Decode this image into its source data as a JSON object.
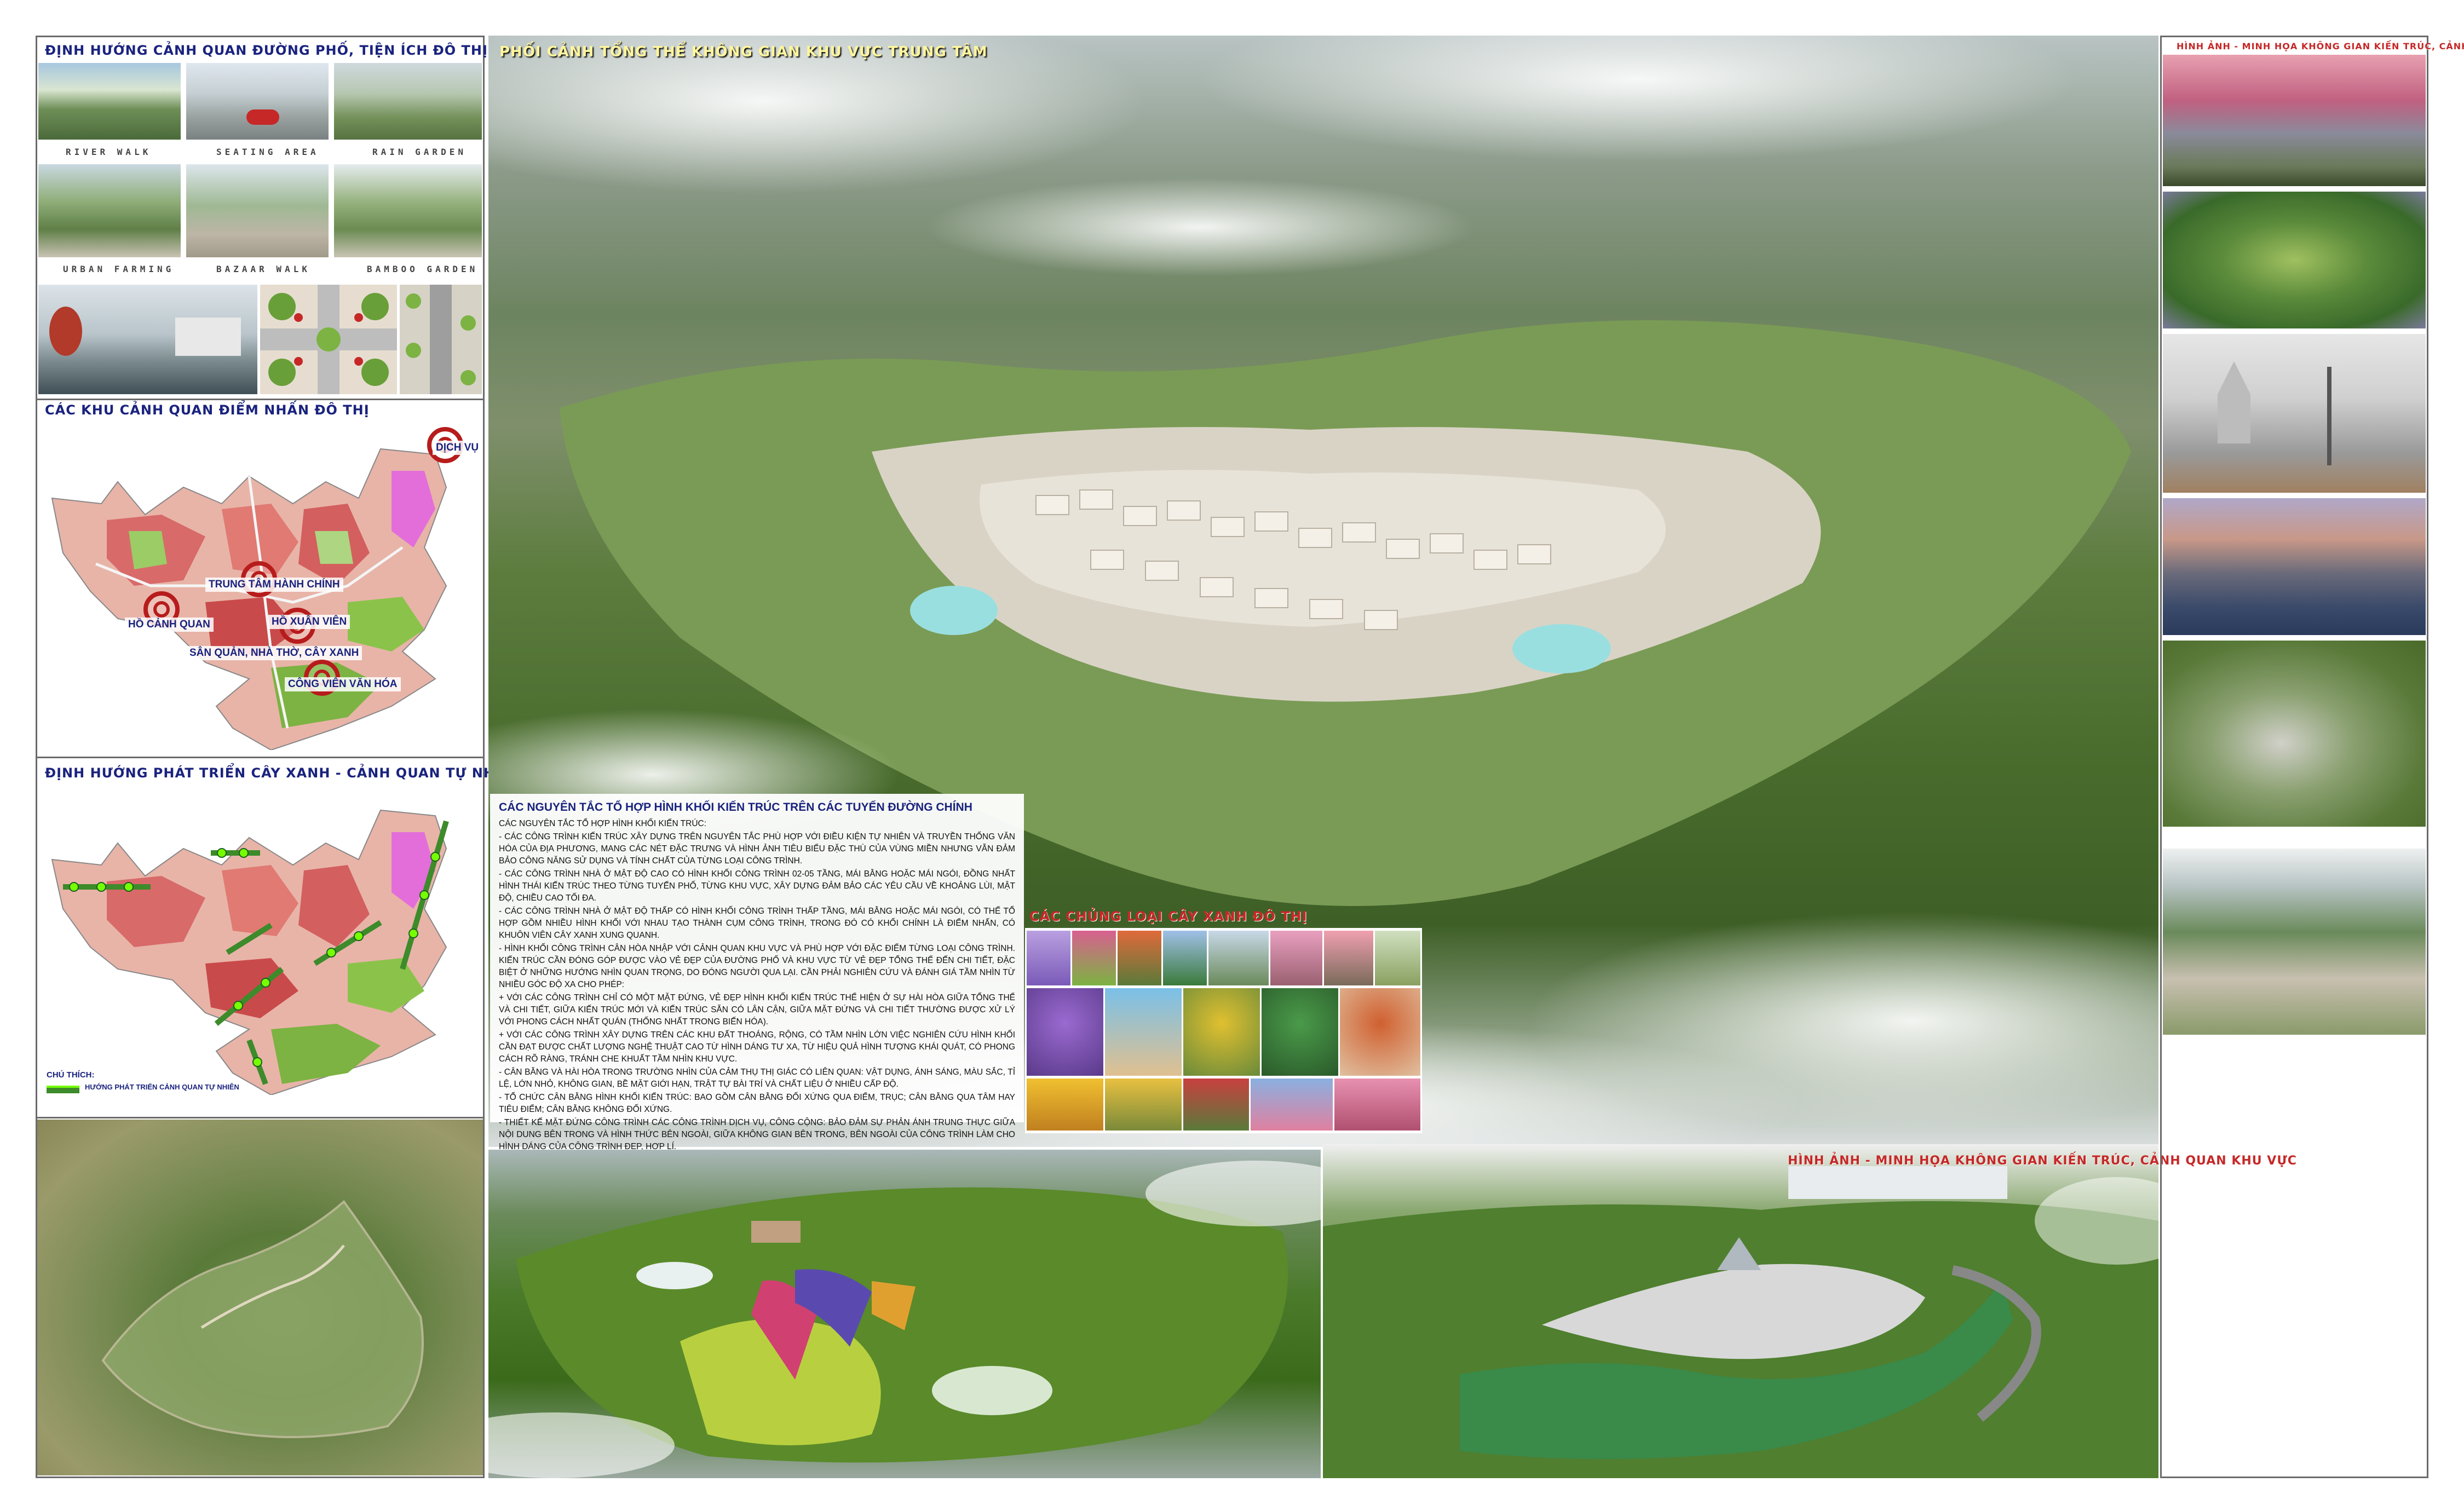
{
  "panels": {
    "street": {
      "title": "ĐỊNH HƯỚNG CẢNH QUAN ĐƯỜNG PHỐ, TIỆN ÍCH ĐÔ THỊ",
      "captions_row1": [
        "RIVER WALK",
        "SEATING AREA",
        "RAIN GARDEN"
      ],
      "captions_row2": [
        "URBAN FARMING",
        "BAZAAR WALK",
        "BAMBOO GARDEN"
      ]
    },
    "landmarks": {
      "title": "CÁC KHU CẢNH QUAN ĐIỂM NHẤN ĐÔ THỊ",
      "labels": {
        "dich_vu": "DỊCH VỤ",
        "trung_tam": "TRUNG TÂM HÀNH CHÍNH",
        "ho_canh_quan": "HỒ CẢNH QUAN",
        "ho_xuan_vien": "HỒ XUÂN VIÊN",
        "san_quan": "SÂN QUẢN, NHÀ THỜ, CÂY XANH",
        "cong_vien": "CÔNG VIÊN VĂN HÓA"
      }
    },
    "green": {
      "title": "ĐỊNH HƯỚNG PHÁT TRIỂN CÂY XANH - CẢNH QUAN TỰ NHIÊN",
      "legend_title": "CHÚ THÍCH:",
      "legend_item": "HƯỚNG PHÁT TRIỂN CẢNH QUAN TỰ NHIÊN"
    },
    "center": {
      "title": "PHỐI CẢNH TỔNG THỂ KHÔNG GIAN KHU VỰC TRUNG TÂM"
    },
    "principles": {
      "title": "CÁC NGUYÊN TẮC TỔ HỢP HÌNH KHỐI KIẾN TRÚC TRÊN CÁC TUYẾN ĐƯỜNG CHÍNH",
      "paragraphs": [
        "CÁC NGUYÊN TẮC TỔ HỢP HÌNH KHỐI KIẾN TRÚC:",
        "- CÁC CÔNG TRÌNH KIẾN TRÚC XÂY DỰNG TRÊN NGUYÊN TẮC PHÙ HỢP VỚI ĐIỀU KIỆN TỰ NHIÊN VÀ TRUYỀN THỐNG VĂN HÓA CỦA ĐỊA PHƯƠNG, MANG CÁC NÉT ĐẶC TRƯNG VÀ HÌNH ẢNH TIÊU BIỂU ĐẶC THÙ CỦA VÙNG MIỀN NHƯNG VẪN ĐẢM BẢO CÔNG NĂNG SỬ DỤNG VÀ TÍNH CHẤT CỦA TỪNG LOẠI CÔNG TRÌNH.",
        "- CÁC CÔNG TRÌNH NHÀ Ở MẬT ĐỘ CAO CÓ HÌNH KHỐI CÔNG TRÌNH 02-05 TẦNG, MÁI BẰNG HOẶC MÁI NGÓI, ĐỒNG NHẤT HÌNH THÁI KIẾN TRÚC THEO TỪNG TUYẾN PHỐ, TỪNG KHU VỰC, XÂY DỰNG ĐẢM BẢO CÁC YÊU CẦU VỀ KHOẢNG LÙI, MẬT ĐỘ, CHIỀU CAO TỐI ĐA.",
        "- CÁC CÔNG TRÌNH NHÀ Ở MẬT ĐỘ THẤP CÓ HÌNH KHỐI CÔNG TRÌNH THẤP TẦNG, MÁI BẰNG HOẶC MÁI NGÓI, CÓ THỂ TỔ HỢP GỒM NHIỀU HÌNH KHỐI VỚI NHAU TẠO THÀNH CỤM CÔNG TRÌNH, TRONG ĐÓ CÓ KHỐI CHÍNH LÀ ĐIỂM NHẤN, CÓ KHUÔN VIÊN CÂY XANH XUNG QUANH.",
        "- HÌNH KHỐI CÔNG TRÌNH CÂN HÒA NHẬP VỚI CẢNH QUAN KHU VỰC VÀ PHÙ HỢP VỚI ĐẶC ĐIỂM TỪNG LOẠI CÔNG TRÌNH. KIẾN TRÚC CẦN ĐÓNG GÓP ĐƯỢC VÀO VẺ ĐẸP CỦA ĐƯỜNG PHỐ VÀ KHU VỰC TỪ VẺ ĐẸP TỔNG THỂ ĐẾN CHI TIẾT, ĐẶC BIỆT Ở NHỮNG HƯỚNG NHÌN QUAN TRỌNG, DO ĐÓNG NGƯỜI QUA LẠI. CẦN PHẢI NGHIÊN CỨU VÀ ĐÁNH GIÁ TẦM NHÌN TỪ NHIỀU GÓC ĐỘ XA CHO PHÉP:",
        "+ VỚI CÁC CÔNG TRÌNH CHỈ CÓ MỘT MẶT ĐỨNG, VẺ ĐẸP HÌNH KHỐI KIẾN TRÚC THỂ HIỆN Ở SỰ HÀI HÒA GIỮA TỔNG THỂ VÀ CHI TIẾT, GIỮA KIẾN TRÚC MỚI VÀ KIẾN TRÚC SẴN CÓ LÂN CẬN, GIỮA MẶT ĐỨNG VÀ CHI TIẾT THƯỜNG ĐƯỢC XỬ LÝ VỚI PHONG CÁCH NHẤT QUÁN (THỐNG NHẤT TRONG BIẾN HÓA).",
        "+ VỚI CÁC CÔNG TRÌNH XÂY DỰNG TRÊN CÁC KHU ĐẤT THOÁNG, RỘNG, CÓ TẦM NHÌN LỚN VIỆC NGHIÊN CỨU HÌNH KHỐI CẦN ĐẠT ĐƯỢC CHẤT LƯỢNG NGHỆ THUẬT CAO TỪ HÌNH DÁNG TƯ XA, TỪ HIỆU QUẢ HÌNH TƯỢNG KHÁI QUÁT, CÓ PHONG CÁCH RÕ RÀNG, TRÁNH CHE KHUẤT TẦM NHÌN KHU VỰC.",
        "- CÂN BẰNG VÀ HÀI HÒA TRONG TRƯỜNG NHÌN CỦA CẢM THỤ THỊ GIÁC CÓ LIÊN QUAN: VẬT DỤNG, ÁNH SÁNG, MÀU SẮC, TỈ LỆ, LỚN NHỎ, KHÔNG GIAN, BỀ MẶT GIỚI HẠN, TRẬT TỰ BÀI TRÍ VÀ CHẤT LIỆU Ở NHIỀU CẤP ĐỘ.",
        "- TỔ CHỨC CÂN BẰNG HÌNH KHỐI KIẾN TRÚC: BAO GỒM CÂN BẰNG ĐỐI XỨNG QUA ĐIỂM, TRỤC; CÂN BẰNG QUA TÂM HAY TIÊU ĐIỂM; CÂN BẰNG KHÔNG ĐỐI XỨNG.",
        "- THIẾT KẾ MẶT ĐỨNG CÔNG TRÌNH CÁC CÔNG TRÌNH DỊCH VỤ, CÔNG CỘNG: BẢO ĐẢM SỰ PHẢN ÁNH TRUNG THỰC GIỮA NỘI DUNG BÊN TRONG VÀ HÌNH THỨC BÊN NGOÀI, GIỮA KHÔNG GIAN BÊN TRONG, BÊN NGOÀI CỦA CÔNG TRÌNH LÀM CHO HÌNH DÁNG CỦA CÔNG TRÌNH ĐẸP, HỢP LÍ."
      ]
    },
    "trees": {
      "title": "CÁC CHỦNG LOẠI CÂY XANH ĐÔ THỊ"
    },
    "right_column": {
      "title": "HÌNH ẢNH - MINH HỌA KHÔNG GIAN KIẾN TRÚC, CẢNH QUAN KHU VỰC"
    },
    "bottom_right": {
      "title": "HÌNH ẢNH - MINH HỌA KHÔNG GIAN KIẾN TRÚC, CẢNH QUAN KHU VỰC"
    }
  }
}
